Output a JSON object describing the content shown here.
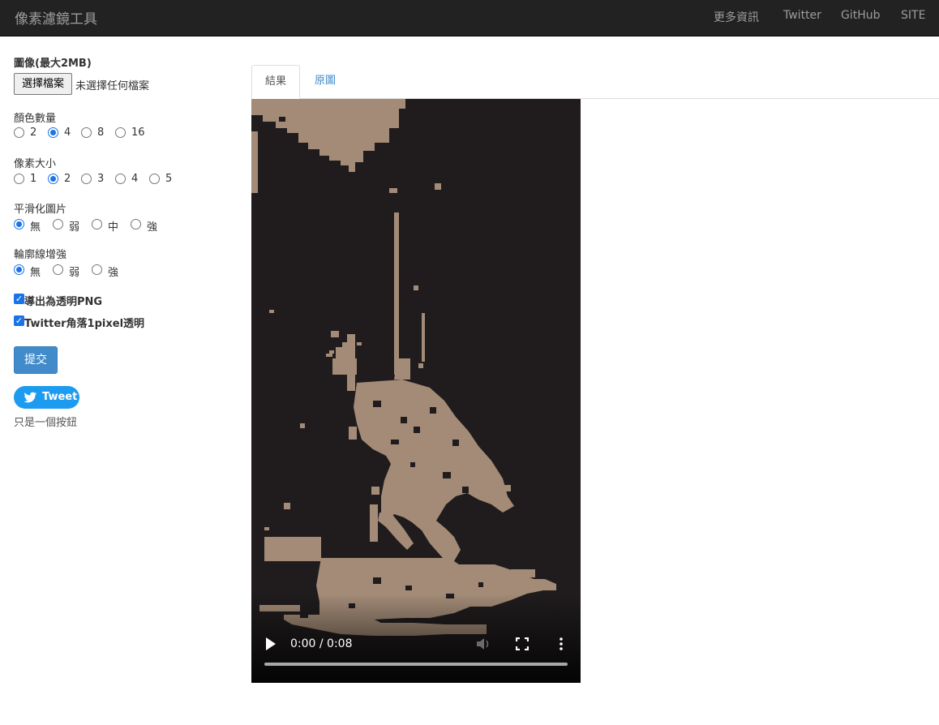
{
  "navbar": {
    "brand": "像素濾鏡工具",
    "links": [
      "更多資訊",
      "Twitter",
      "GitHub",
      "SITE"
    ]
  },
  "form": {
    "image_label": "圖像(最大2MB)",
    "file_button": "選擇檔案",
    "file_status": "未選擇任何檔案",
    "colors": {
      "label": "顏色數量",
      "options": [
        "2",
        "4",
        "8",
        "16"
      ],
      "selected": "4"
    },
    "pixel_size": {
      "label": "像素大小",
      "options": [
        "1",
        "2",
        "3",
        "4",
        "5"
      ],
      "selected": "2"
    },
    "smoothing": {
      "label": "平滑化圖片",
      "options": [
        "無",
        "弱",
        "中",
        "強"
      ],
      "selected": "無"
    },
    "edge": {
      "label": "輪廓線增強",
      "options": [
        "無",
        "弱",
        "強"
      ],
      "selected": "無"
    },
    "export_png": {
      "label": "導出為透明PNG",
      "checked": true
    },
    "twitter_corner": {
      "label": "Twitter角落1pixel透明",
      "checked": true
    },
    "submit": "提交"
  },
  "tweet": {
    "label": "Tweet",
    "note": "只是一個按鈕"
  },
  "tabs": [
    {
      "label": "結果",
      "active": true
    },
    {
      "label": "原圖",
      "active": false
    }
  ],
  "video": {
    "time": "0:00 / 0:08",
    "progress": 0,
    "palette": {
      "dark": "#201c1d",
      "light": "#a38b77"
    }
  },
  "colors": {
    "navbar": "#222222",
    "nav_text": "#9d9d9d",
    "primary": "#428bca",
    "radio": "#1a73e8",
    "tweet": "#1d9bf0"
  }
}
